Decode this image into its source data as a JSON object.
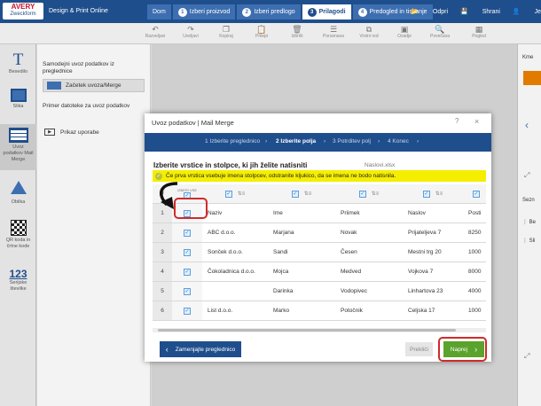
{
  "app": {
    "logo_line1": "AVERY",
    "logo_line2": "Zweckform",
    "title": "Design & Print Online"
  },
  "steps": [
    {
      "label": "Dom",
      "num": ""
    },
    {
      "label": "Izberi proizvod",
      "num": "1"
    },
    {
      "label": "Izberi predlogo",
      "num": "2"
    },
    {
      "label": "Prilagodi",
      "num": "3"
    },
    {
      "label": "Predogled in tiskanje",
      "num": "4"
    }
  ],
  "topright": {
    "open": "Odpri",
    "save": "Shrani",
    "user": "Je"
  },
  "toolbar": [
    "Razveljavi",
    "Uveljavi",
    "Kopiraj",
    "Prilepi",
    "Izbriši",
    "Poravnava",
    "Vrstni red",
    "Ozadje",
    "Povečava",
    "Pogled"
  ],
  "sidebar": [
    {
      "label": "Besedilo",
      "icon": "text-icon"
    },
    {
      "label": "Slika",
      "icon": "image-icon"
    },
    {
      "label": "Uvoz podatkov Mail Merge",
      "icon": "table-icon"
    },
    {
      "label": "Oblika",
      "icon": "shapes-icon"
    },
    {
      "label": "QR koda in črtne kode",
      "icon": "qr-icon"
    },
    {
      "label": "Serijske številke",
      "icon": "numbering-icon"
    }
  ],
  "panel": {
    "heading": "Samodejni uvoz podatkov iz preglednice",
    "start_button": "Začetek uvoza/Merge",
    "example_text": "Primer datoteke za uvoz podatkov",
    "guide": "Prikaz uporabe"
  },
  "right_panel": {
    "label1": "Kme",
    "label2": "Sezn",
    "item1": "Be",
    "item2": "Sli"
  },
  "dialog": {
    "title": "Uvoz podatkov | Mail Merge",
    "help": "?",
    "close": "×",
    "wizard": [
      "1 Izberite preglednico",
      "2 Izberite polja",
      "3 Potrditev polj",
      "4 Konec"
    ],
    "heading": "Izberite vrstice in stolpce, ki jih želite natisniti",
    "filename": "Naslovi.xlsx",
    "notice": "Če prva vrstica vsebuje imena stolpcev, odstranite kljukico, da se imena ne bodo natisnila.",
    "header_hash": "#",
    "header_small": "IZBERI VSE",
    "back_button": "Zamenjajte preglednico",
    "cancel_button": "Prekliči",
    "next_button": "Naprej"
  },
  "rows": [
    {
      "n": "1",
      "c": [
        "Naziv",
        "Ime",
        "Priimek",
        "Naslov",
        "Posti"
      ]
    },
    {
      "n": "2",
      "c": [
        "ABC d.o.o.",
        "Marjana",
        "Novak",
        "Prijateljeva 7",
        "8250"
      ]
    },
    {
      "n": "3",
      "c": [
        "Sonček d.o.o.",
        "Sandi",
        "Česen",
        "Mestni trg 20",
        "1000"
      ]
    },
    {
      "n": "4",
      "c": [
        "Čokoladnica d.o.o.",
        "Mojca",
        "Medved",
        "Vojkova 7",
        "8000"
      ]
    },
    {
      "n": "5",
      "c": [
        "",
        "Darinka",
        "Vodopivec",
        "Linhartova 23",
        "4000"
      ]
    },
    {
      "n": "6",
      "c": [
        "List d.o.o.",
        "Marko",
        "Potočnik",
        "Celjska 17",
        "1000"
      ]
    }
  ]
}
